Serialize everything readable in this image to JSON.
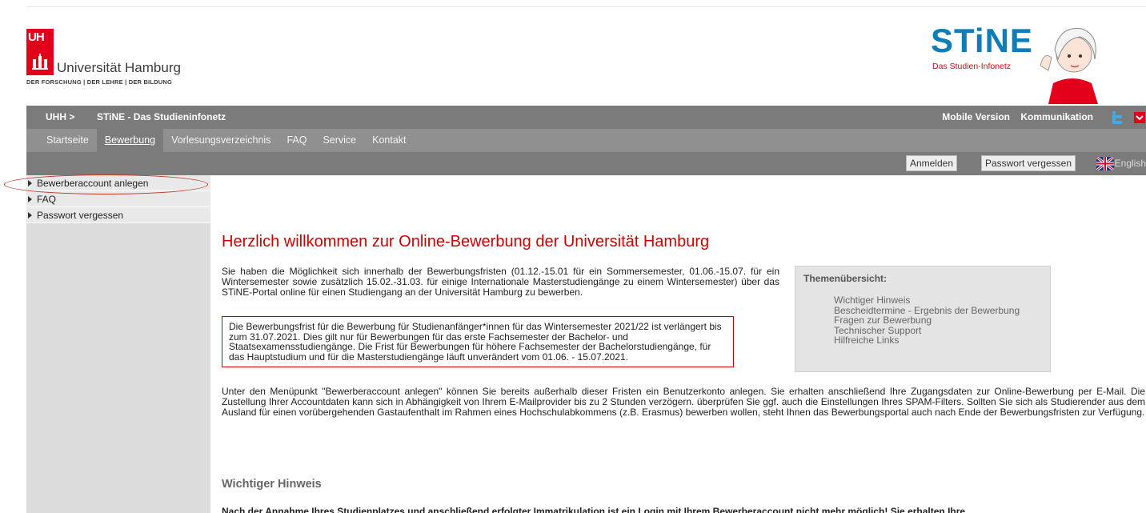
{
  "header": {
    "logo_short": "UH",
    "university_name": "Universität Hamburg",
    "tagline": "DER FORSCHUNG | DER LEHRE | DER BILDUNG",
    "stine_word": "STiNE",
    "stine_subtitle": "Das Studien-Infonetz"
  },
  "topbar": {
    "breadcrumb_root": "UHH >",
    "breadcrumb_current": "STiNE - Das Studieninfonetz",
    "mobile_version": "Mobile Version",
    "communication": "Kommunikation"
  },
  "nav": {
    "items": [
      "Startseite",
      "Bewerbung",
      "Vorlesungsverzeichnis",
      "FAQ",
      "Service",
      "Kontakt"
    ],
    "active": "Bewerbung"
  },
  "account_bar": {
    "login": "Anmelden",
    "forgot_password": "Passwort vergessen",
    "language": "English"
  },
  "sidebar": {
    "items": [
      "Bewerberaccount anlegen",
      "FAQ",
      "Passwort vergessen"
    ]
  },
  "main": {
    "headline": "Herzlich willkommen zur Online-Bewerbung der Universität Hamburg",
    "intro": "Sie haben die Möglichkeit sich innerhalb der Bewerbungsfristen (01.12.-15.01 für ein Sommersemester, 01.06.-15.07. für ein Wintersemester sowie zusätzlich 15.02.-31.03. für einige Internationale Masterstudiengänge zu einem Wintersemester) über das STiNE-Portal online für einen Studiengang an der Universität Hamburg zu bewerben.",
    "notice": "Die Bewerbungsfrist für die Bewerbung für Studienanfänger*innen für das Wintersemester 2021/22 ist verlängert bis zum 31.07.2021. Dies gilt nur für Bewerbungen für das erste Fachsemester der Bachelor- und Staatsexamensstudiengänge. Die Frist für Bewerbungen für höhere Fachsemester der Bachelorstudiengänge, für das Hauptstudium und für die Masterstudiengänge läuft unverändert vom 01.06. - 15.07.2021.",
    "topics_title": "Themenübersicht:",
    "topics": [
      "Wichtiger Hinweis",
      "Bescheidtermine - Ergebnis der Bewerbung",
      "Fragen zur Bewerbung",
      "Technischer Support",
      "Hilfreiche Links"
    ],
    "para2": "Unter den Menüpunkt \"Bewerberaccount anlegen\" können Sie bereits außerhalb dieser Fristen ein Benutzerkonto anlegen. Sie erhalten anschließend Ihre Zugangsdaten zur Online-Bewerbung per E-Mail. Die Zustellung Ihrer Accountdaten kann sich in Abhängigkeit von Ihrem E-Mailprovider bis zu 2 Stunden verzögern. überprüfen Sie ggf. auch die Einstellungen Ihres SPAM-Filters. Sollten Sie sich als Studierender aus dem Ausland für einen vorübergehenden Gastaufenthalt im Rahmen eines Hochschulabkommens (z.B. Erasmus) bewerben wollen, steht Ihnen das Bewerbungsportal auch nach Ende der Bewerbungsfristen zur Verfügung.",
    "subhead": "Wichtiger Hinweis",
    "bold_note_before": "Nach der Annahme Ihres Studienplatzes und anschließend erfolgter Immatrikulation ist ein Login mit Ihrem Bewerberaccount ",
    "bold_note_emph": "nicht",
    "bold_note_after": " mehr möglich! Sie erhalten Ihre"
  },
  "colors": {
    "brand_red": "#e2001a",
    "stine_blue": "#0f7db8",
    "bar_grey": "#7b7b7b",
    "headline_red": "#cc0000"
  }
}
